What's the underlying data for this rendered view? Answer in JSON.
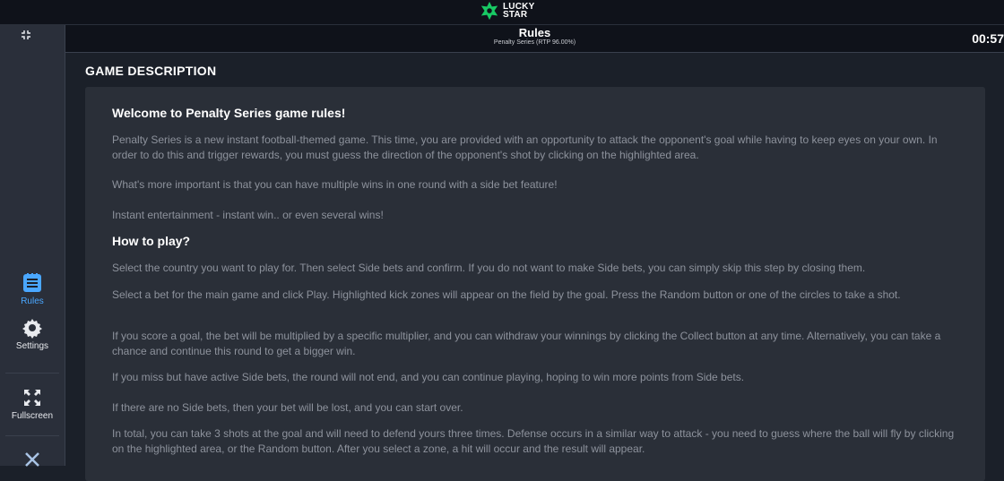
{
  "brand": {
    "line1": "LUCKY",
    "line2": "STAR",
    "accent": "#18c964"
  },
  "header": {
    "title": "Rules",
    "subtitle": "Penalty Series (RTP 96.00%)",
    "timer": "00:57"
  },
  "sidebar": {
    "items": [
      {
        "label": "Rules",
        "icon": "rules-icon",
        "active": true
      },
      {
        "label": "Settings",
        "icon": "gear-icon",
        "active": false
      },
      {
        "label": "Fullscreen",
        "icon": "fullscreen-icon",
        "active": false
      }
    ],
    "active_color": "#4aa7ff"
  },
  "section": {
    "title": "GAME DESCRIPTION"
  },
  "content": {
    "welcome_title": "Welcome to Penalty Series game rules!",
    "p1": "Penalty Series is a new instant football-themed game. This time, you are provided with an opportunity to attack the opponent's goal while having to keep eyes on your own. In order to do this and trigger rewards, you must guess the direction of the opponent's shot by clicking on the highlighted area.",
    "p2": "What's more important is that you can have multiple wins in one round with a side bet feature!",
    "p3": "Instant entertainment - instant win.. or even several wins!",
    "how_title": "How to play?",
    "p4": "Select the country you want to play for. Then select Side bets and confirm. If you do not want to make Side bets, you can simply skip this step by closing them.",
    "p5": "Select a bet for the main game and click Play. Highlighted kick zones will appear on the field by the goal. Press the Random button or one of the circles to take a shot.",
    "p6": "If you score a goal, the bet will be multiplied by a specific multiplier, and you can withdraw your winnings by clicking the Collect button at any time. Alternatively, you can take a chance and continue this round to get a bigger win.",
    "p7": "If you miss but have active Side bets, the round will not end, and you can continue playing, hoping to win more points from Side bets.",
    "p8": "If there are no Side bets, then your bet will be lost, and you can start over.",
    "p9": "In total, you can take 3 shots at the goal and will need to defend yours three times. Defense occurs in a similar way to attack - you need to guess where the ball will fly by clicking on the highlighted area, or the Random button. After you select a zone, a hit will occur and the result will appear."
  }
}
